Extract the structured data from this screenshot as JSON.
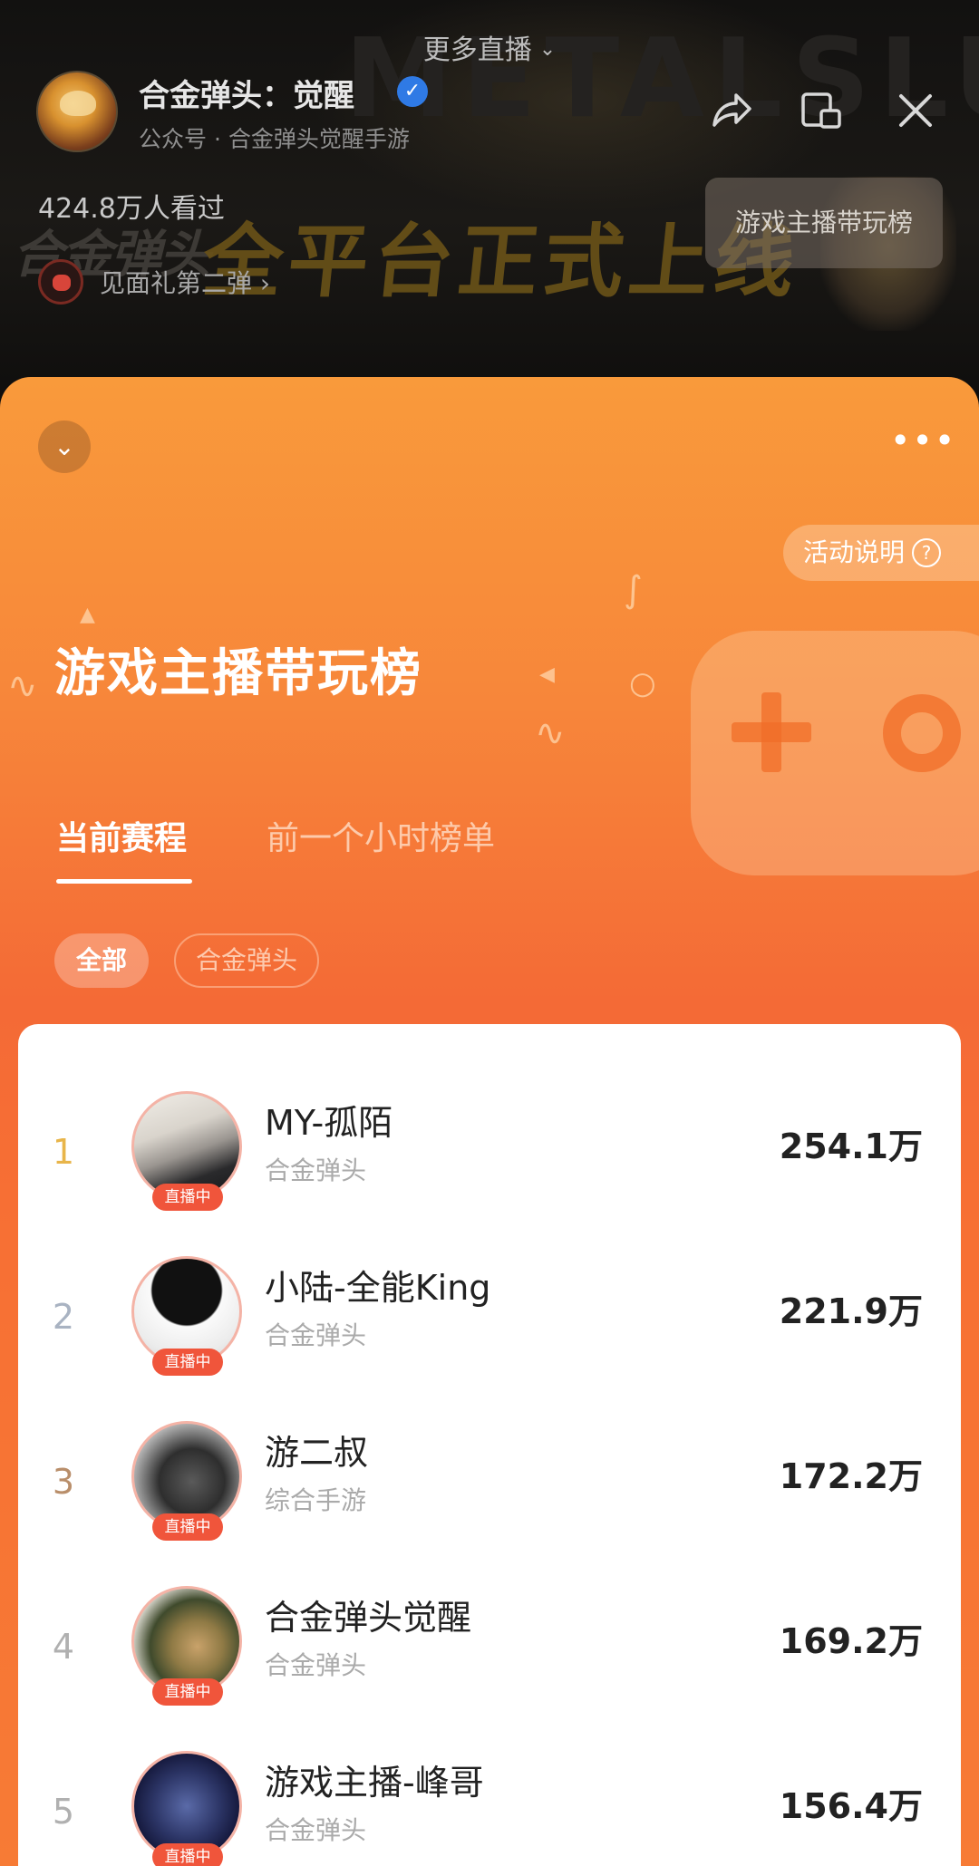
{
  "header": {
    "more_live": "更多直播",
    "channel_name": "合金弹头：觉醒",
    "channel_sub": "公众号 · 合金弹头觉醒手游",
    "viewer_count": "424.8万人看过",
    "gift_text": "见面礼第二弹",
    "rank_chip": "游戏主播带玩榜",
    "banner_text": "全平台正式上线",
    "banner_logo": "合金弹头"
  },
  "panel": {
    "rules_label": "活动说明",
    "title": "游戏主播带玩榜",
    "tabs": [
      {
        "label": "当前赛程",
        "active": true
      },
      {
        "label": "前一个小时榜单",
        "active": false
      }
    ],
    "filters": [
      {
        "label": "全部",
        "active": true
      },
      {
        "label": "合金弹头",
        "active": false
      }
    ]
  },
  "ranking": {
    "live_label": "直播中",
    "rows": [
      {
        "rank": "1",
        "name": "MY-孤陌",
        "category": "合金弹头",
        "score": "254.1万",
        "rank_color": "#e8b54a"
      },
      {
        "rank": "2",
        "name": "小陆-全能King",
        "category": "合金弹头",
        "score": "221.9万",
        "rank_color": "#a9b3c2"
      },
      {
        "rank": "3",
        "name": "游二叔",
        "category": "综合手游",
        "score": "172.2万",
        "rank_color": "#b98e6a"
      },
      {
        "rank": "4",
        "name": "合金弹头觉醒",
        "category": "合金弹头",
        "score": "169.2万",
        "rank_color": "#b0b0b0"
      },
      {
        "rank": "5",
        "name": "游戏主播-峰哥",
        "category": "合金弹头",
        "score": "156.4万",
        "rank_color": "#b0b0b0"
      }
    ]
  },
  "colors": {
    "accent_orange": "#f7863a",
    "live_badge": "#f0553b",
    "verified_blue": "#2f7ae5"
  },
  "icons": [
    "chevron-down-icon",
    "verified-icon",
    "share-icon",
    "pip-icon",
    "close-icon",
    "gift-icon",
    "more-icon",
    "help-icon",
    "gamepad-icon"
  ]
}
